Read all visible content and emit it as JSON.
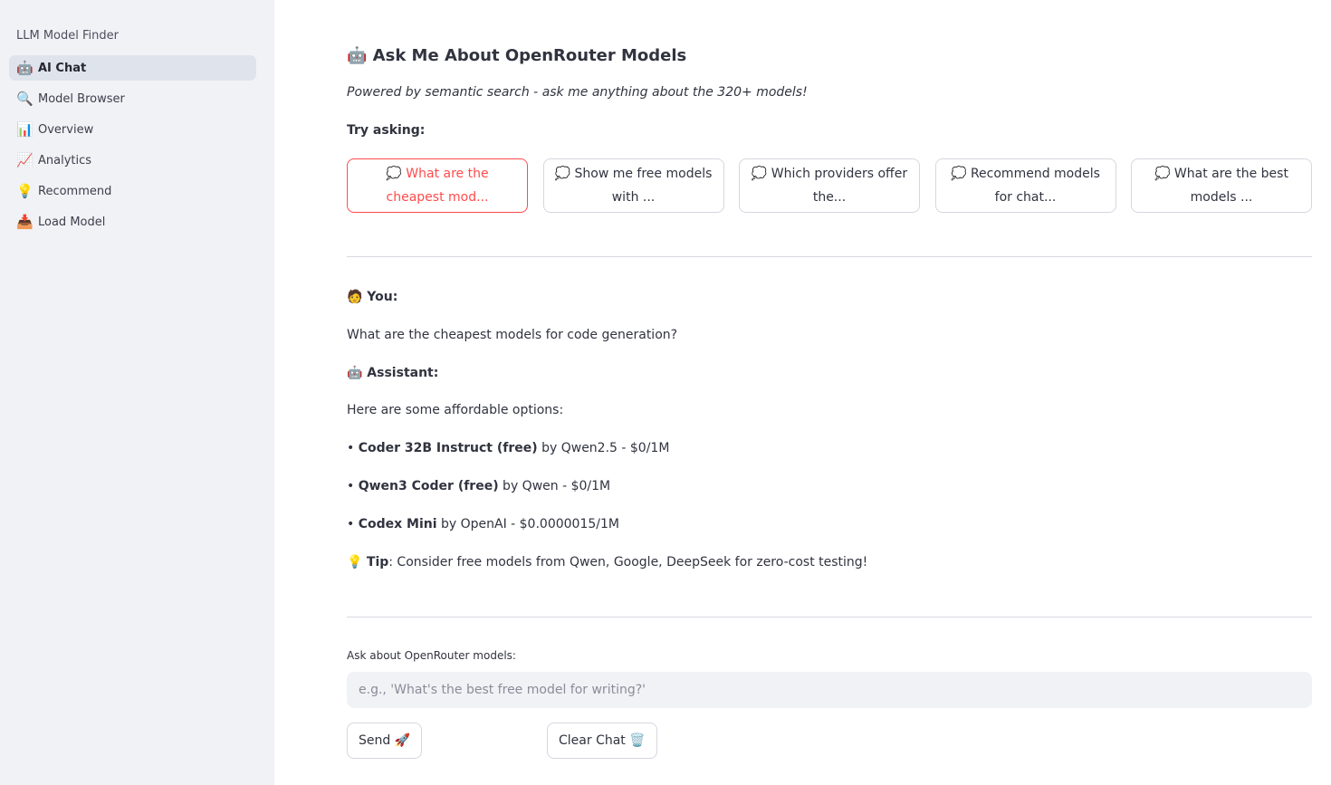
{
  "sidebar": {
    "title": "LLM Model Finder",
    "items": [
      {
        "icon": "🤖",
        "label": "AI Chat",
        "active": true
      },
      {
        "icon": "🔍",
        "label": "Model Browser"
      },
      {
        "icon": "📊",
        "label": "Overview"
      },
      {
        "icon": "📈",
        "label": "Analytics"
      },
      {
        "icon": "💡",
        "label": "Recommend"
      },
      {
        "icon": "📥",
        "label": "Load Model"
      }
    ]
  },
  "main": {
    "title": "🤖 Ask Me About OpenRouter Models",
    "subtitle": "Powered by semantic search - ask me anything about the 320+ models!",
    "try_label": "Try asking:",
    "suggestions": [
      "💭 What are the cheapest mod...",
      "💭 Show me free models with ...",
      "💭 Which providers offer the...",
      "💭 Recommend models for chat...",
      "💭 What are the best models ..."
    ]
  },
  "chat": {
    "user_label": "🧑 You:",
    "user_message": "What are the cheapest models for code generation?",
    "assistant_label": "🤖 Assistant:",
    "intro": "Here are some affordable options:",
    "models": [
      {
        "name": "Coder 32B Instruct (free)",
        "rest": " by Qwen2.5 - $0/1M"
      },
      {
        "name": "Qwen3 Coder (free)",
        "rest": " by Qwen - $0/1M"
      },
      {
        "name": "Codex Mini",
        "rest": " by OpenAI - $0.0000015/1M"
      }
    ],
    "tip_icon": "💡",
    "tip_label": "Tip",
    "tip_text": ": Consider free models from Qwen, Google, DeepSeek for zero-cost testing!"
  },
  "input": {
    "label": "Ask about OpenRouter models:",
    "placeholder": "e.g., 'What's the best free model for writing?'",
    "value": ""
  },
  "buttons": {
    "send": "Send 🚀",
    "clear": "Clear Chat 🗑️"
  },
  "colors": {
    "accent": "#ff4b4b",
    "sidebar_bg": "#f0f2f6",
    "active_nav_bg": "#dfe3ec"
  }
}
